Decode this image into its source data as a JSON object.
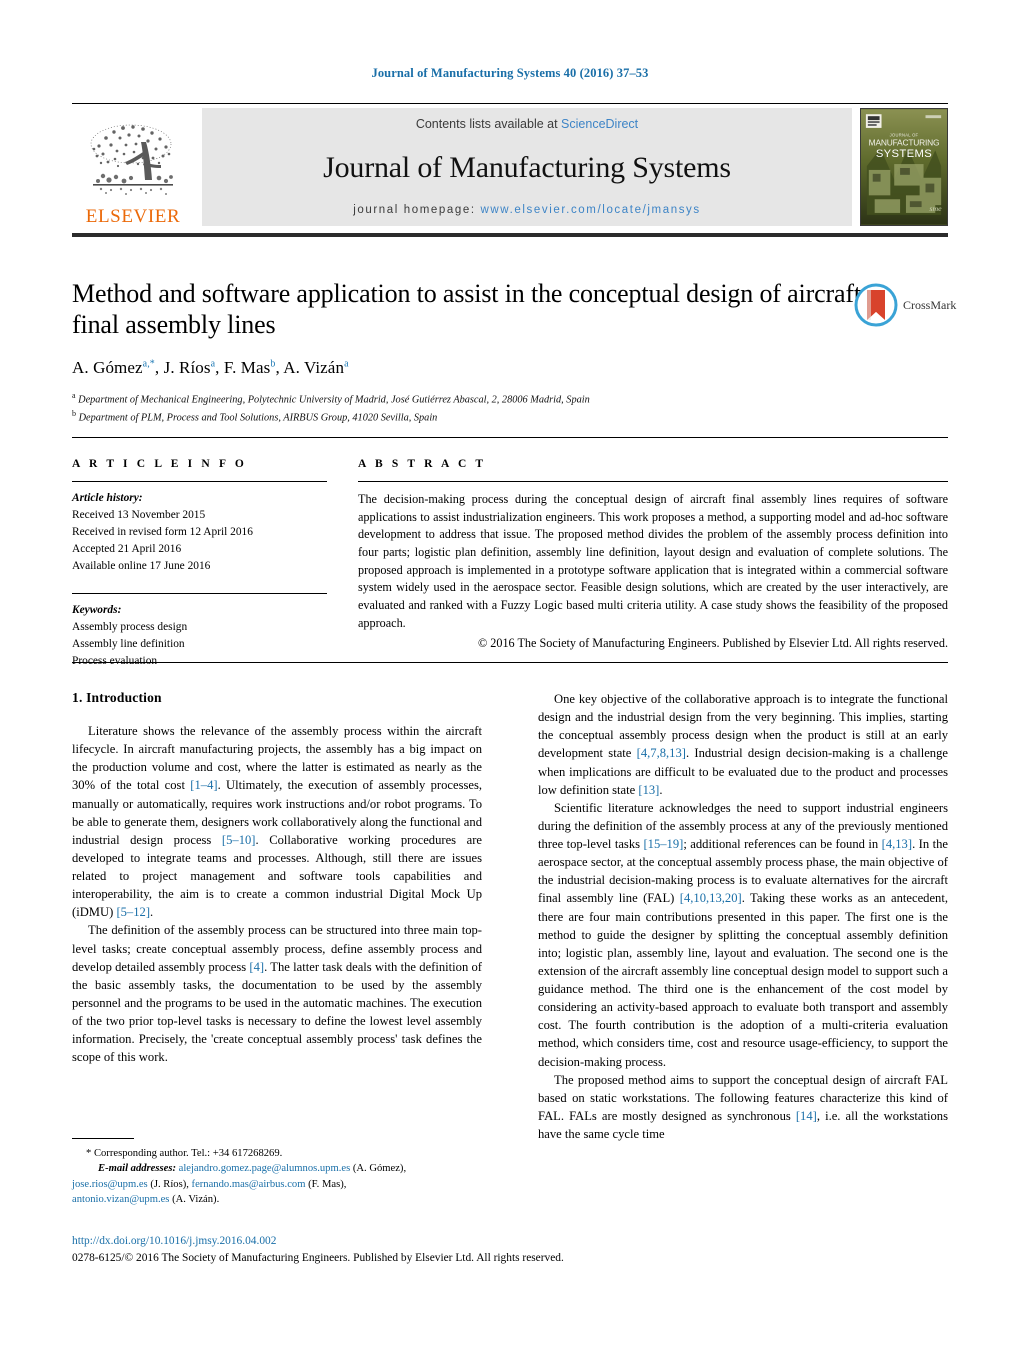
{
  "running_head": "Journal of Manufacturing Systems 40 (2016) 37–53",
  "masthead": {
    "contents_prefix": "Contents lists available at ",
    "contents_link": "ScienceDirect",
    "journal_title": "Journal of Manufacturing Systems",
    "homepage_prefix": "journal homepage: ",
    "homepage_url": "www.elsevier.com/locate/jmansys",
    "publisher_wordmark": "ELSEVIER",
    "cover_line1": "JOURNAL OF",
    "cover_line2": "MANUFACTURING",
    "cover_line3": "SYSTEMS",
    "link_color": "#3d84c6",
    "elsevier_orange": "#eb6909",
    "band_color": "#e6e6e6"
  },
  "article": {
    "title": "Method and software application to assist in the conceptual design of aircraft final assembly lines",
    "authors_html": "A. Gómez<sup>a,*</sup>, J. Ríos<sup>a</sup>, F. Mas<sup>b</sup>, A. Vizán<sup>a</sup>",
    "affiliation_a": "Department of Mechanical Engineering, Polytechnic University of Madrid, José Gutiérrez Abascal, 2, 28006 Madrid, Spain",
    "affiliation_b": "Department of PLM, Process and Tool Solutions, AIRBUS Group, 41020 Sevilla, Spain",
    "crossmark_label": "CrossMark"
  },
  "info": {
    "heading": "A R T I C L E   I N F O",
    "history_label": "Article history:",
    "history": [
      "Received 13 November 2015",
      "Received in revised form 12 April 2016",
      "Accepted 21 April 2016",
      "Available online 17 June 2016"
    ],
    "keywords_label": "Keywords:",
    "keywords": [
      "Assembly process design",
      "Assembly line definition",
      "Process evaluation"
    ]
  },
  "abstract": {
    "heading": "A B S T R A C T",
    "text": "The decision-making process during the conceptual design of aircraft final assembly lines requires of software applications to assist industrialization engineers. This work proposes a method, a supporting model and ad-hoc software development to address that issue. The proposed method divides the problem of the assembly process definition into four parts; logistic plan definition, assembly line definition, layout design and evaluation of complete solutions. The proposed approach is implemented in a prototype software application that is integrated within a commercial software system widely used in the aerospace sector. Feasible design solutions, which are created by the user interactively, are evaluated and ranked with a Fuzzy Logic based multi criteria utility. A case study shows the feasibility of the proposed approach.",
    "copyright": "© 2016 The Society of Manufacturing Engineers. Published by Elsevier Ltd. All rights reserved."
  },
  "body": {
    "section_heading": "1.  Introduction",
    "left_paragraphs": [
      "Literature shows the relevance of the assembly process within the aircraft lifecycle. In aircraft manufacturing projects, the assembly has a big impact on the production volume and cost, where the latter is estimated as nearly as the 30% of the total cost [1–4]. Ultimately, the execution of assembly processes, manually or automatically, requires work instructions and/or robot programs. To be able to generate them, designers work collaboratively along the functional and industrial design process [5–10]. Collaborative working procedures are developed to integrate teams and processes. Although, still there are issues related to project management and software tools capabilities and interoperability, the aim is to create a common industrial Digital Mock Up (iDMU) [5–12].",
      "The definition of the assembly process can be structured into three main top-level tasks; create conceptual assembly process, define assembly process and develop detailed assembly process [4]. The latter task deals with the definition of the basic assembly tasks, the documentation to be used by the assembly personnel and the programs to be used in the automatic machines. The execution of the two prior top-level tasks is necessary to define the lowest level assembly information. Precisely, the 'create conceptual assembly process' task defines the scope of this work."
    ],
    "right_paragraphs": [
      "One key objective of the collaborative approach is to integrate the functional design and the industrial design from the very beginning. This implies, starting the conceptual assembly process design when the product is still at an early development state [4,7,8,13]. Industrial design decision-making is a challenge when implications are difficult to be evaluated due to the product and processes low definition state [13].",
      "Scientific literature acknowledges the need to support industrial engineers during the definition of the assembly process at any of the previously mentioned three top-level tasks [15–19]; additional references can be found in [4,13]. In the aerospace sector, at the conceptual assembly process phase, the main objective of the industrial decision-making process is to evaluate alternatives for the aircraft final assembly line (FAL) [4,10,13,20]. Taking these works as an antecedent, there are four main contributions presented in this paper. The first one is the method to guide the designer by splitting the conceptual assembly definition into; logistic plan, assembly line, layout and evaluation. The second one is the extension of the aircraft assembly line conceptual design model to support such a guidance method. The third one is the enhancement of the cost model by considering an activity-based approach to evaluate both transport and assembly cost. The fourth contribution is the adoption of a multi-criteria evaluation method, which considers time, cost and resource usage-efficiency, to support the decision-making process.",
      "The proposed method aims to support the conceptual design of aircraft FAL based on static workstations. The following features characterize this kind of FAL. FALs are mostly designed as synchronous [14], i.e. all the workstations have the same cycle time"
    ]
  },
  "footnotes": {
    "corresponding": "* Corresponding author. Tel.: +34 617268269.",
    "email_label": "E-mail addresses:",
    "emails": [
      {
        "address": "alejandro.gomez.page@alumnos.upm.es",
        "name": "(A. Gómez),"
      },
      {
        "address": "jose.rios@upm.es",
        "name": "(J. Ríos),"
      },
      {
        "address": "fernando.mas@airbus.com",
        "name": "(F. Mas),"
      },
      {
        "address": "antonio.vizan@upm.es",
        "name": "(A. Vizán)."
      }
    ]
  },
  "doi_block": {
    "doi_url": "http://dx.doi.org/10.1016/j.jmsy.2016.04.002",
    "issn_line": "0278-6125/© 2016 The Society of Manufacturing Engineers. Published by Elsevier Ltd. All rights reserved."
  }
}
